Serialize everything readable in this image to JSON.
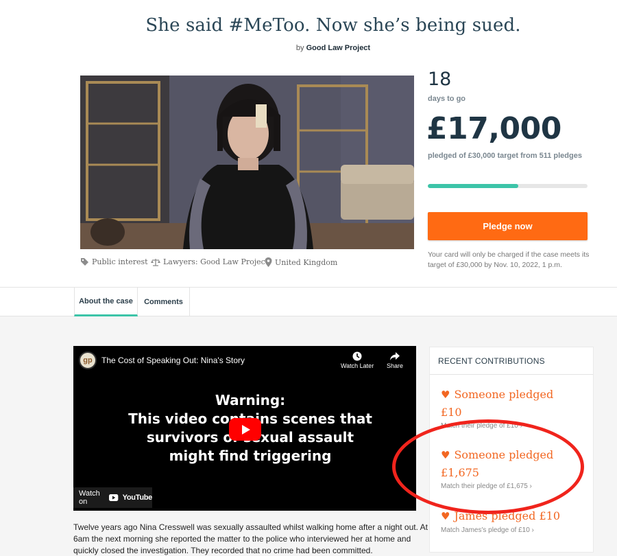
{
  "page": {
    "title": "She said #MeToo. Now she’s being sued.",
    "byline_prefix": "by",
    "byline_org": "Good Law Project"
  },
  "case_meta": {
    "category": "Public interest",
    "lawyers": "Lawyers: Good Law Project",
    "location": "United Kingdom"
  },
  "stats": {
    "days": "18",
    "days_label": "days to go",
    "amount": "£17,000",
    "amount_label": "pledged of £30,000 target from 511 pledges",
    "progress_fraction": 0.567,
    "pledge_button": "Pledge now",
    "card_note": "Your card will only be charged if the case meets its target of £30,000 by Nov. 10, 2022, 1 p.m."
  },
  "tabs": [
    {
      "label": "About the case",
      "active": true
    },
    {
      "label": "Comments",
      "active": false
    }
  ],
  "video": {
    "channel_logo": "gp",
    "title": "The Cost of Speaking Out: Nina's Story",
    "watch_later": "Watch Later",
    "share": "Share",
    "warning_line1": "Warning:",
    "warning_line2": "This video contains scenes that",
    "warning_line3": "survivors of sexual assault",
    "warning_line4": "might find triggering",
    "watch_on": "Watch on",
    "youtube": "YouTube"
  },
  "story": "Twelve years ago Nina Cresswell was sexually assaulted whilst walking home after a night out. At 6am the next morning she reported the matter to the police who interviewed her at home and quickly closed the investigation. They recorded that no crime had been committed.",
  "recent_contributions": {
    "heading": "RECENT CONTRIBUTIONS",
    "items": [
      {
        "line1": "Someone pledged",
        "line2": "£10",
        "match": "Match their pledge of £10"
      },
      {
        "line1": "Someone pledged",
        "line2": "£1,675",
        "match": "Match their pledge of £1,675"
      },
      {
        "line1": "James pledged £10",
        "line2": "",
        "match": "Match James's pledge of £10"
      }
    ]
  },
  "colors": {
    "accent_teal": "#3cc4a8",
    "pledge_orange": "#ff6a13",
    "contribution_orange": "#f26722",
    "annotation_red": "#f0241c"
  }
}
